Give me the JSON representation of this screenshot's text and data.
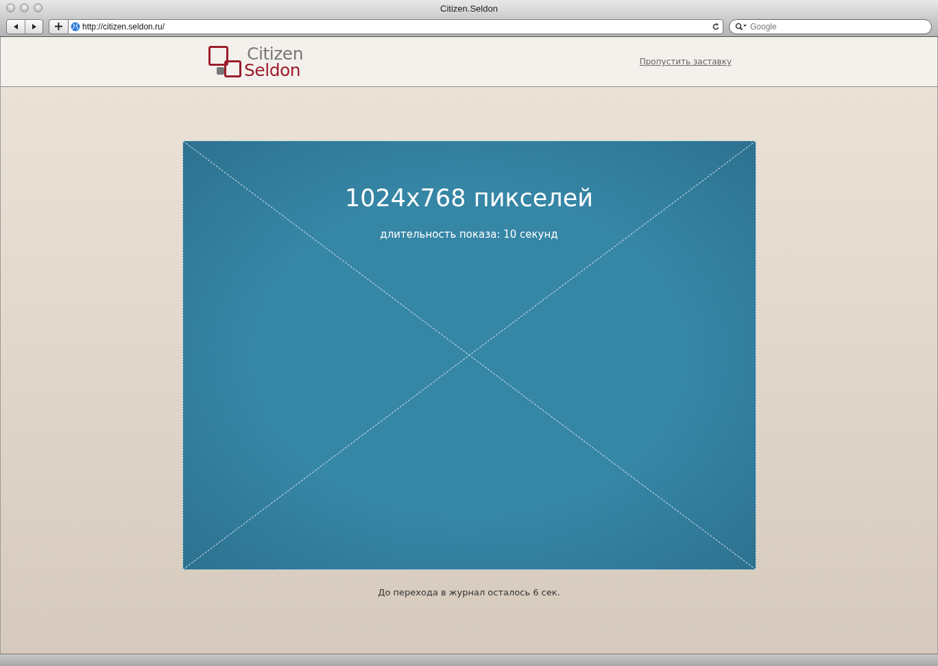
{
  "window": {
    "title": "Citizen.Seldon"
  },
  "toolbar": {
    "address": "http://citizen.seldon.ru/",
    "search": {
      "placeholder": "Google"
    }
  },
  "header": {
    "logo": [
      "Citizen",
      "Seldon"
    ],
    "skip_link": "Пропустить заставку"
  },
  "banner": {
    "title": "1024x768 пикселей",
    "subtitle": "длительность показа: 10 секунд"
  },
  "countdown": "До перехода в журнал осталось 6 сек."
}
